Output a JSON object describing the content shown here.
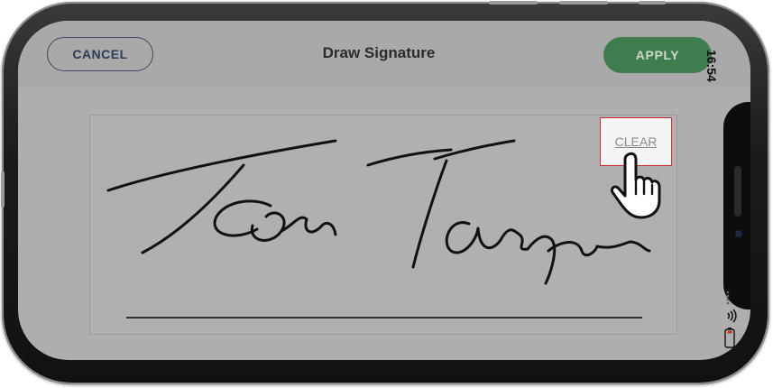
{
  "header": {
    "cancel_label": "CANCEL",
    "title": "Draw Signature",
    "apply_label": "APPLY"
  },
  "pad": {
    "clear_label": "CLEAR"
  },
  "status_bar": {
    "time": "16:54",
    "icons": [
      "signal-dots-icon",
      "wifi-icon",
      "battery-icon"
    ]
  },
  "colors": {
    "apply_bg": "#3f7d4f",
    "cancel_border": "#3b4a63",
    "clear_highlight": "#d03030",
    "screen_bg": "#aeaeae"
  }
}
